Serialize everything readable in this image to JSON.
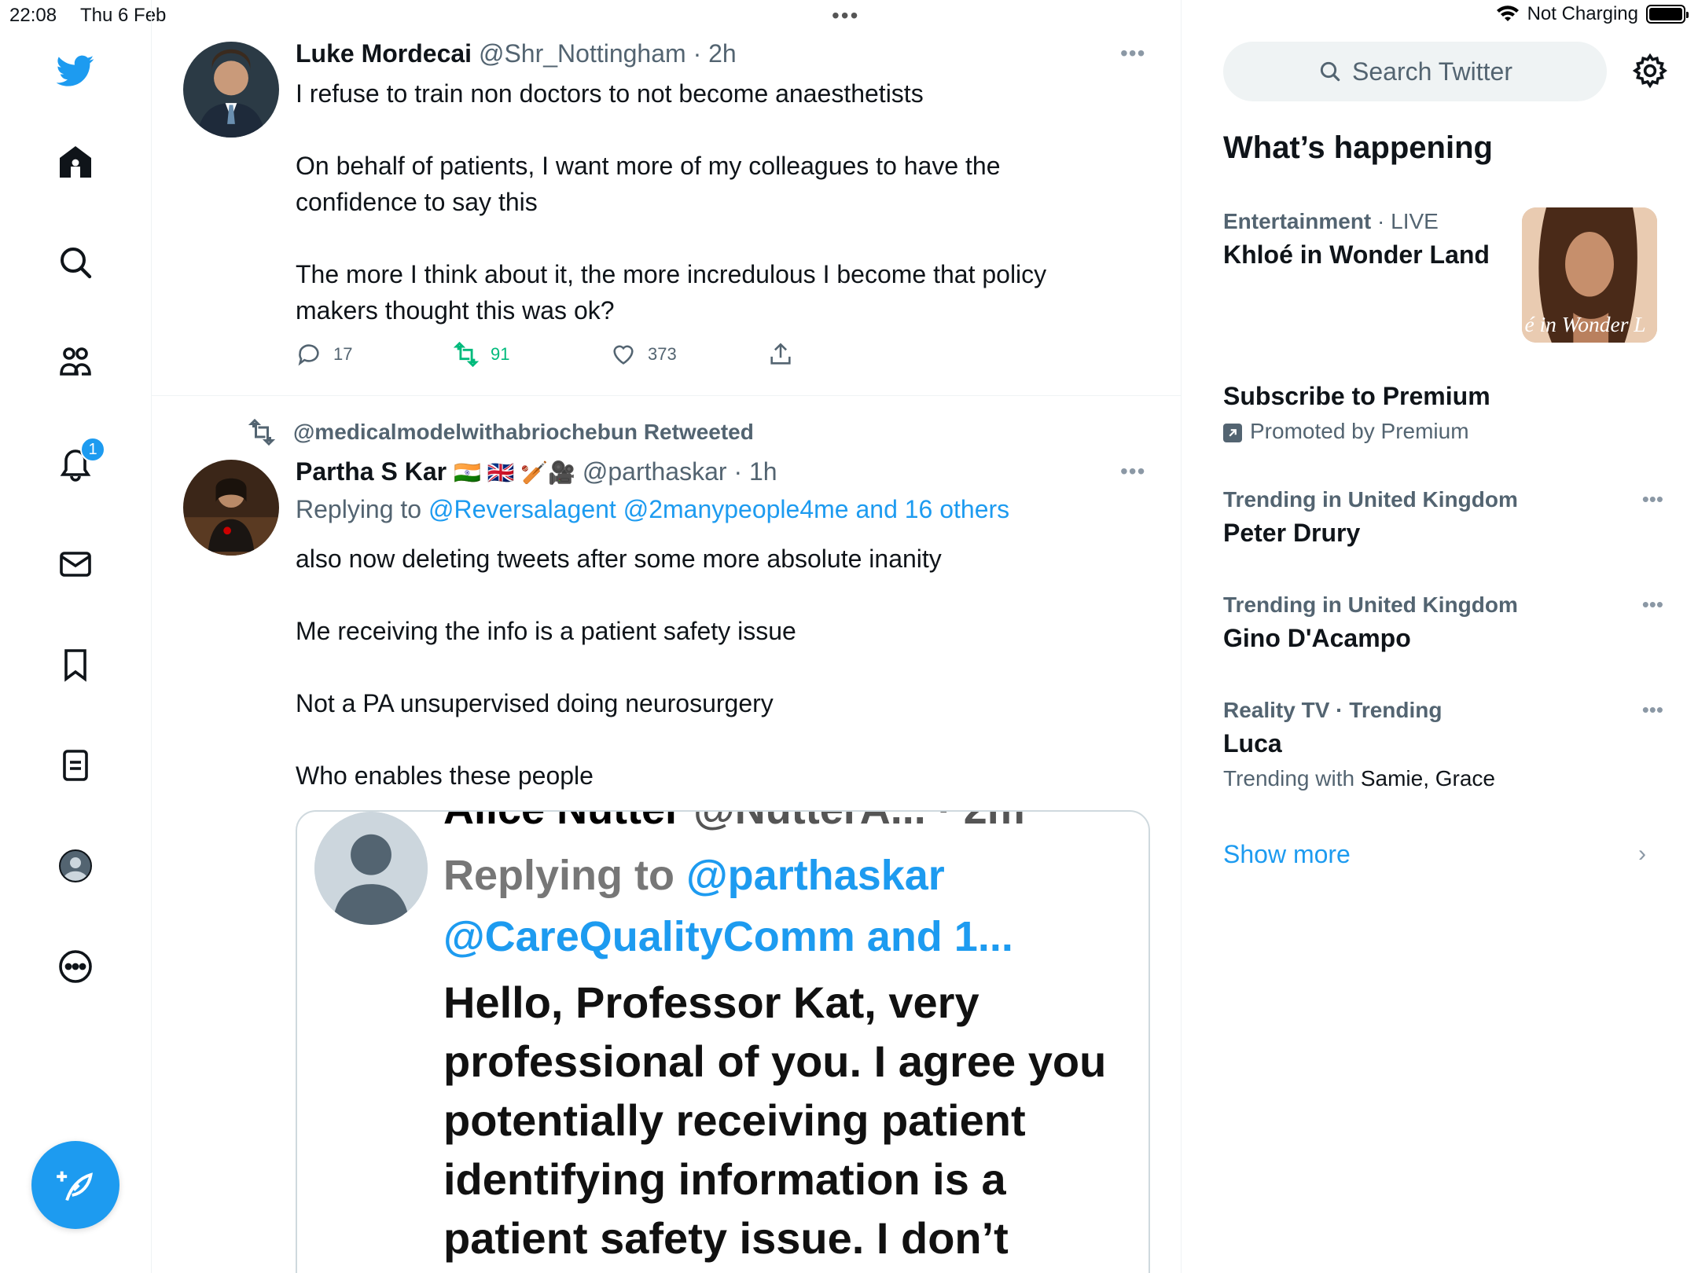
{
  "status_bar": {
    "time": "22:08",
    "date": "Thu 6 Feb",
    "charging": "Not Charging",
    "battery_level": 1.0
  },
  "nav": {
    "notifications_count": "1",
    "accent_color": "#1d9bf0"
  },
  "tweets": [
    {
      "name": "Luke Mordecai",
      "handle": "@Shr_Nottingham",
      "time": "· 2h",
      "body": [
        "I refuse to train non doctors to not become anaesthetists",
        "On behalf of patients, I want more of my colleagues to have the confidence to say this",
        "The more I think about it, the more incredulous I become that policy makers thought this was ok?"
      ],
      "replies": "17",
      "retweets": "91",
      "likes": "373"
    },
    {
      "retweeted_by": "@medicalmodelwithabriochebun Retweeted",
      "name": "Partha S Kar",
      "flags": "🇮🇳 🇬🇧 🏏🎥",
      "handle": "@parthaskar",
      "time": "· 1h",
      "replying_prefix": "Replying to",
      "replying_to": "@Reversalagent @2manypeople4me and 16 others",
      "body": [
        "also now deleting tweets after some more absolute inanity",
        "Me receiving the info is a patient safety issue",
        "Not a PA unsupervised doing neurosurgery",
        "Who enables these people"
      ],
      "embed": {
        "cut_header_name": "Alice Nutter",
        "cut_header_handle": "@NutterA... · 2m",
        "replying_prefix": "Replying to",
        "replying_handle": "@parthaskar",
        "replying_more": "@CareQualityComm and 1...",
        "text": "Hello, Professor Kat, very professional of you. I agree you potentially receiving patient identifying information is a patient safety issue. I don’t"
      }
    }
  ],
  "right": {
    "search_placeholder": "Search Twitter",
    "whats_happening": "What’s happening",
    "trends": [
      {
        "category": "Entertainment",
        "status": "· LIVE",
        "title": "Khloé in Wonder Land",
        "image_caption": "é in Wonder L"
      },
      {
        "title": "Subscribe to Premium",
        "promoted": "Promoted by Premium"
      },
      {
        "category": "Trending in United Kingdom",
        "title": "Peter Drury"
      },
      {
        "category": "Trending in United Kingdom",
        "title": "Gino D'Acampo"
      },
      {
        "category": "Reality TV · Trending",
        "title": "Luca",
        "sub_prefix": "Trending with",
        "sub_names": "Samie, Grace"
      }
    ],
    "show_more": "Show more"
  }
}
